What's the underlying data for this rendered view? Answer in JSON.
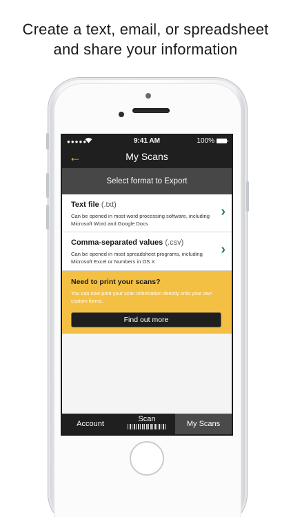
{
  "headline": {
    "line1": "Create a text, email, or spreadsheet",
    "line2": "and share your information"
  },
  "status_bar": {
    "signal": "●●●●●",
    "time": "9:41 AM",
    "battery": "100%"
  },
  "nav": {
    "back_icon": "←",
    "title": "My Scans"
  },
  "section_header": "Select format to Export",
  "formats": [
    {
      "title": "Text file",
      "ext": "(.txt)",
      "description": "Can be opened in most word processing software, including Microsoft Word and Google Docs",
      "chevron": "›"
    },
    {
      "title": "Comma-separated values",
      "ext": "(.csv)",
      "description": "Can be opened in most spreadsheet programs, including Microsoft Excel or Numbers in OS X",
      "chevron": "›"
    }
  ],
  "promo": {
    "title": "Need to print your scans?",
    "text": "You can now print your scan information directly onto your own custom forms.",
    "button": "Find out more"
  },
  "tabs": {
    "account": "Account",
    "scan": "Scan",
    "my_scans": "My Scans"
  },
  "colors": {
    "accent_yellow": "#f3c043",
    "chevron_teal": "#1b7a78",
    "bar_dark": "#1f1f1f"
  }
}
